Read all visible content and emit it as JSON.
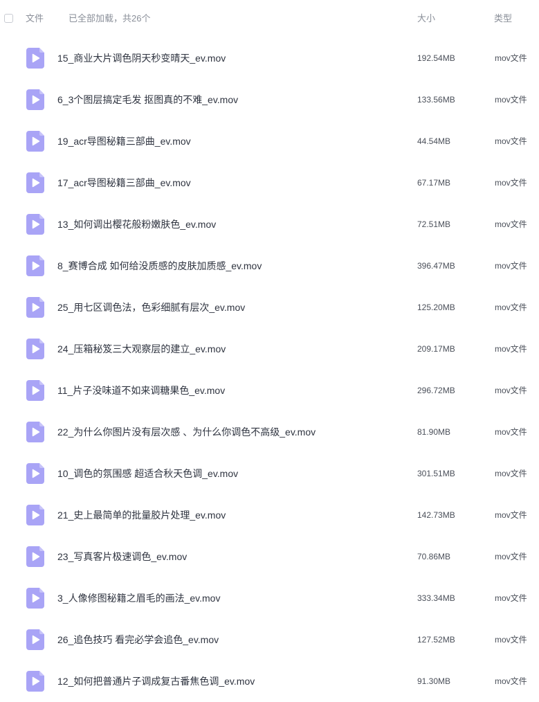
{
  "header": {
    "name_label": "文件",
    "status_text": "已全部加载，共26个",
    "size_label": "大小",
    "type_label": "类型"
  },
  "icon": {
    "name": "video-file-icon",
    "color": "#a9a4f6",
    "play_color": "#ffffff"
  },
  "files": [
    {
      "name": "15_商业大片调色阴天秒变晴天_ev.mov",
      "size": "192.54MB",
      "type": "mov文件"
    },
    {
      "name": "6_3个图层搞定毛发 抠图真的不难_ev.mov",
      "size": "133.56MB",
      "type": "mov文件"
    },
    {
      "name": "19_acr导图秘籍三部曲_ev.mov",
      "size": "44.54MB",
      "type": "mov文件"
    },
    {
      "name": "17_acr导图秘籍三部曲_ev.mov",
      "size": "67.17MB",
      "type": "mov文件"
    },
    {
      "name": "13_如何调出樱花般粉嫩肤色_ev.mov",
      "size": "72.51MB",
      "type": "mov文件"
    },
    {
      "name": "8_赛博合成 如何给没质感的皮肤加质感_ev.mov",
      "size": "396.47MB",
      "type": "mov文件"
    },
    {
      "name": "25_用七区调色法，色彩细腻有层次_ev.mov",
      "size": "125.20MB",
      "type": "mov文件"
    },
    {
      "name": "24_压箱秘笈三大观察层的建立_ev.mov",
      "size": "209.17MB",
      "type": "mov文件"
    },
    {
      "name": "11_片子没味道不如来调糖果色_ev.mov",
      "size": "296.72MB",
      "type": "mov文件"
    },
    {
      "name": "22_为什么你图片没有层次感 、为什么你调色不高级_ev.mov",
      "size": "81.90MB",
      "type": "mov文件"
    },
    {
      "name": "10_调色的氛围感 超适合秋天色调_ev.mov",
      "size": "301.51MB",
      "type": "mov文件"
    },
    {
      "name": "21_史上最简单的批量胶片处理_ev.mov",
      "size": "142.73MB",
      "type": "mov文件"
    },
    {
      "name": "23_写真客片极速调色_ev.mov",
      "size": "70.86MB",
      "type": "mov文件"
    },
    {
      "name": "3_人像修图秘籍之眉毛的画法_ev.mov",
      "size": "333.34MB",
      "type": "mov文件"
    },
    {
      "name": "26_追色技巧 看完必学会追色_ev.mov",
      "size": "127.52MB",
      "type": "mov文件"
    },
    {
      "name": "12_如何把普通片子调成复古番焦色调_ev.mov",
      "size": "91.30MB",
      "type": "mov文件"
    }
  ]
}
